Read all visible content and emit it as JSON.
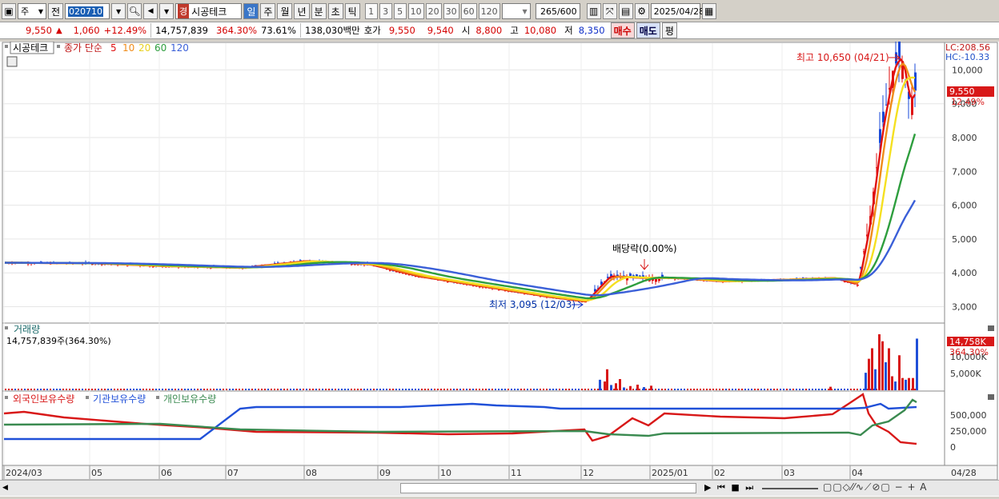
{
  "toolbar": {
    "market": "주",
    "prev": "전",
    "code": "020710",
    "badge": "경",
    "stock_name": "시공테크",
    "periods": [
      "일",
      "주",
      "월",
      "년",
      "분",
      "초",
      "틱"
    ],
    "active_period": "일",
    "intervals": [
      "1",
      "3",
      "5",
      "10",
      "20",
      "30",
      "60",
      "120"
    ],
    "count": "265",
    "count_total": "/600",
    "date": "2025/04/28"
  },
  "quote": {
    "price": "9,550",
    "change": "1,060",
    "change_pct": "+12.49%",
    "volume": "14,757,839",
    "volume_ratio": "364.30%",
    "turnover": "73.61%",
    "amount": "138,030백만",
    "bid_label": "호가",
    "ask": "9,550",
    "bid": "9,540",
    "open_label": "시",
    "open": "8,800",
    "high_label": "고",
    "high": "10,080",
    "low_label": "저",
    "low": "8,350",
    "buy_label": "매수",
    "sell_label": "매도",
    "avg_label": "평"
  },
  "legend": {
    "name": "시공테크",
    "ma_label": "종가 단순",
    "ma": [
      {
        "period": "5",
        "color": "#e01010"
      },
      {
        "period": "10",
        "color": "#f08c1a"
      },
      {
        "period": "20",
        "color": "#f5e020"
      },
      {
        "period": "60",
        "color": "#2e9e3e"
      },
      {
        "period": "120",
        "color": "#3a5fd8"
      }
    ],
    "lc": "LC:208.56",
    "hc": "HC:-10.33"
  },
  "price_pane": {
    "axis": [
      "10,000",
      "9,000",
      "8,000",
      "7,000",
      "6,000",
      "5,000",
      "4,000",
      "3,000"
    ],
    "ann_high": "최고 10,650 (04/21)",
    "ann_low": "최저 3,095 (12/03)",
    "ann_div": "배당락(0.00%)",
    "tag_price": "9,550",
    "tag_pct": "12.49%"
  },
  "volume_pane": {
    "title": "거래량",
    "value": "14,757,839주(364.30%)",
    "axis": [
      "10,000K",
      "5,000K"
    ],
    "tag_value": "14,758K",
    "tag_pct": "364.30%"
  },
  "holding_pane": {
    "series": [
      {
        "name": "외국인보유수량",
        "color": "#d81818"
      },
      {
        "name": "기관보유수량",
        "color": "#2050d8"
      },
      {
        "name": "개인보유수량",
        "color": "#3a8a50"
      }
    ],
    "axis": [
      "500,000",
      "250,000",
      "0"
    ]
  },
  "x_axis": {
    "labels": [
      "2024/03",
      "05",
      "06",
      "07",
      "08",
      "09",
      "10",
      "11",
      "12",
      "2025/01",
      "02",
      "03",
      "04"
    ],
    "right_label": "04/28"
  },
  "chart_data": {
    "type": "candlestick",
    "ma_series": [
      "5",
      "10",
      "20",
      "60",
      "120"
    ],
    "high": {
      "value": 10650,
      "date": "04/21"
    },
    "low": {
      "value": 3095,
      "date": "12/03"
    },
    "price_ylim": [
      2800,
      10600
    ],
    "last": {
      "price": 9550,
      "pct": 12.49,
      "volume": 14757839
    }
  }
}
